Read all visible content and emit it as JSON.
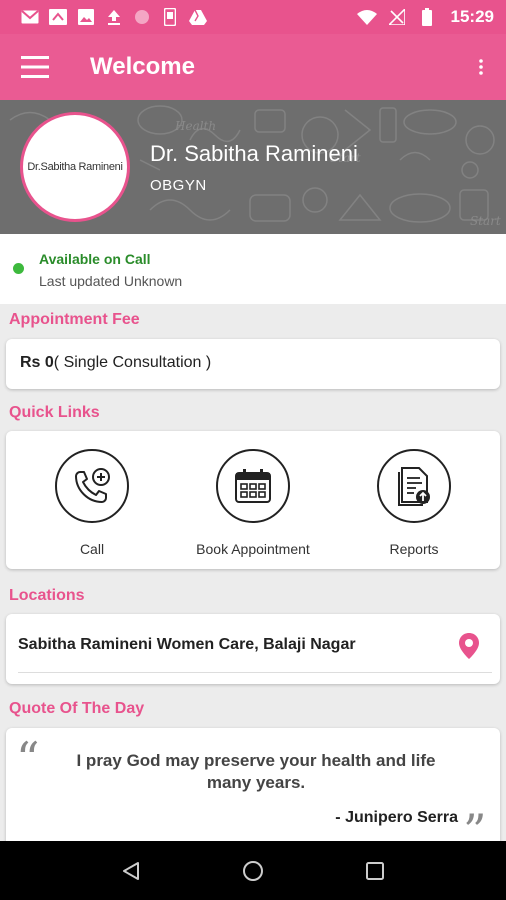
{
  "status_bar": {
    "time": "15:29",
    "icons": [
      "gmail-icon",
      "missed-call-icon",
      "image-icon",
      "upload-icon",
      "circle-icon",
      "phone-icon",
      "drive-icon"
    ],
    "right_icons": [
      "wifi-icon",
      "no-signal-icon",
      "battery-icon"
    ]
  },
  "app_bar": {
    "title": "Welcome",
    "menu_icon": "hamburger-menu-icon",
    "overflow_icon": "more-vert-icon"
  },
  "profile": {
    "avatar_text": "Dr.Sabitha Ramineni",
    "name": "Dr. Sabitha Ramineni",
    "specialty": "OBGYN"
  },
  "availability": {
    "status": "Available on Call",
    "last_updated": "Last updated Unknown",
    "status_color": "#3db93d"
  },
  "appointment_fee": {
    "title": "Appointment Fee",
    "amount": "Rs 0",
    "detail": "( Single Consultation )"
  },
  "quick_links": {
    "title": "Quick Links",
    "items": [
      {
        "label": "Call",
        "icon": "phone-plus-icon"
      },
      {
        "label": "Book Appointment",
        "icon": "calendar-icon"
      },
      {
        "label": "Reports",
        "icon": "document-upload-icon"
      }
    ]
  },
  "locations": {
    "title": "Locations",
    "items": [
      {
        "name": "Sabitha Ramineni Women Care, Balaji Nagar",
        "icon": "location-pin-icon"
      }
    ]
  },
  "quote": {
    "title": "Quote Of The Day",
    "open_mark": "“",
    "close_mark": "”",
    "text": "I pray God may preserve your health and life many years.",
    "author": "- Junipero Serra"
  },
  "nav_bar": {
    "buttons": [
      "back-icon",
      "home-icon",
      "recents-icon"
    ]
  },
  "colors": {
    "accent": "#e8538d",
    "app_bar": "#ea5b93",
    "available": "#3db93d"
  }
}
